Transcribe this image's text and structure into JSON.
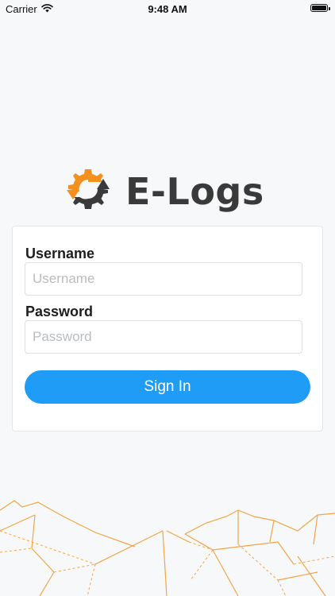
{
  "status_bar": {
    "carrier": "Carrier",
    "time": "9:48 AM"
  },
  "logo": {
    "text": "E-Logs",
    "icon": "gear-refresh-icon"
  },
  "login": {
    "username_label": "Username",
    "username_placeholder": "Username",
    "username_value": "",
    "password_label": "Password",
    "password_placeholder": "Password",
    "password_value": "",
    "sign_in_label": "Sign In"
  },
  "colors": {
    "accent": "#1e9cf6",
    "logo_orange": "#f4911e",
    "logo_gray": "#3a3a3a",
    "decor_line": "#f0a646"
  }
}
